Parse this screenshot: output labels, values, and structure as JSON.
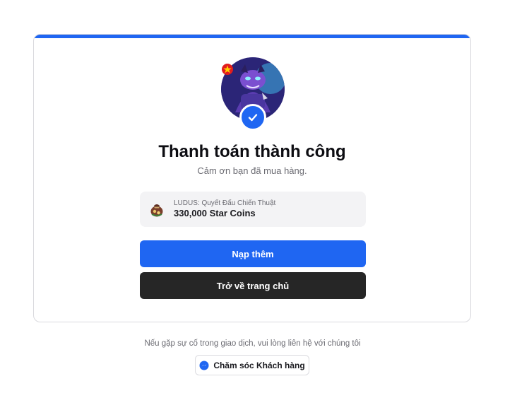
{
  "status": {
    "title": "Thanh toán thành công",
    "subtitle": "Cảm ơn bạn đã mua hàng."
  },
  "order": {
    "game": "LUDUS: Quyết Đấu Chiến Thuật",
    "amount": "330,000 Star Coins"
  },
  "actions": {
    "topup_label": "Nạp thêm",
    "home_label": "Trở về trang chủ"
  },
  "support": {
    "text": "Nếu gặp sự cố trong giao dịch, vui lòng liên hệ với chúng tôi",
    "button_label": "Chăm sóc Khách hàng"
  },
  "icons": {
    "success": "check-icon",
    "product": "coin-bag-icon",
    "support": "messenger-icon"
  },
  "colors": {
    "accent": "#1f66f2",
    "dark_button": "#262626"
  }
}
